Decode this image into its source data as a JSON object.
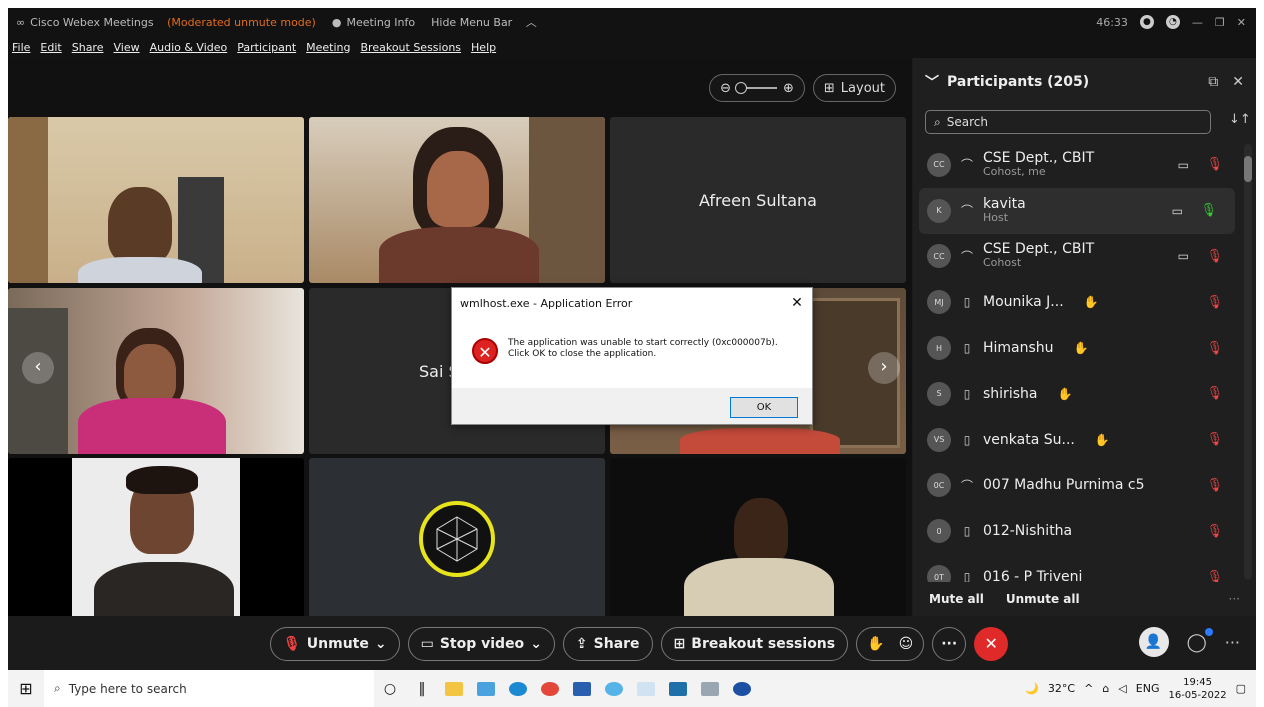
{
  "titlebar": {
    "app": "Cisco Webex Meetings",
    "mode": "(Moderated unmute mode)",
    "meeting_info": "Meeting Info",
    "hide_menu": "Hide Menu Bar",
    "timer": "46:33"
  },
  "menu": [
    "File",
    "Edit",
    "Share",
    "View",
    "Audio & Video",
    "Participant",
    "Meeting",
    "Breakout Sessions",
    "Help"
  ],
  "stage": {
    "layout_label": "Layout",
    "tiles": [
      {
        "name": "Afreen Sultana"
      },
      {
        "name": "Sai S"
      }
    ]
  },
  "dialog": {
    "title": "wmlhost.exe - Application Error",
    "message_line1": "The application was unable to start correctly (0xc000007b).",
    "message_line2": "Click OK to close the application.",
    "ok": "OK"
  },
  "panel": {
    "title": "Participants (205)",
    "search_placeholder": "Search",
    "participants": [
      {
        "initials": "CC",
        "name": "CSE Dept., CBIT",
        "role": "Cohost, me",
        "device": "headset",
        "video": true,
        "mic": "muted"
      },
      {
        "initials": "K",
        "name": "kavita",
        "role": "Host",
        "device": "headset",
        "video": true,
        "mic": "on"
      },
      {
        "initials": "CC",
        "name": "CSE Dept., CBIT",
        "role": "Cohost",
        "device": "headset",
        "video": true,
        "mic": "muted"
      },
      {
        "initials": "MJ",
        "name": "Mounika J...",
        "role": "",
        "device": "mobile",
        "hand": true,
        "mic": "muted"
      },
      {
        "initials": "H",
        "name": "Himanshu",
        "role": "",
        "device": "mobile",
        "hand": true,
        "mic": "muted"
      },
      {
        "initials": "S",
        "name": "shirisha",
        "role": "",
        "device": "mobile",
        "hand": true,
        "mic": "muted"
      },
      {
        "initials": "VS",
        "name": "venkata Su...",
        "role": "",
        "device": "mobile",
        "hand": true,
        "mic": "muted"
      },
      {
        "initials": "0C",
        "name": "007 Madhu Purnima c5",
        "role": "",
        "device": "headset",
        "mic": "muted"
      },
      {
        "initials": "0",
        "name": "012-Nishitha",
        "role": "",
        "device": "mobile",
        "mic": "muted"
      },
      {
        "initials": "0T",
        "name": "016 - P Triveni",
        "role": "",
        "device": "mobile",
        "mic": "muted"
      }
    ],
    "mute_all": "Mute all",
    "unmute_all": "Unmute all"
  },
  "controls": {
    "unmute": "Unmute",
    "stop_video": "Stop video",
    "share": "Share",
    "breakout": "Breakout sessions"
  },
  "taskbar": {
    "search_placeholder": "Type here to search",
    "weather": "32°C",
    "lang": "ENG",
    "time": "19:45",
    "date": "16-05-2022"
  },
  "colors": {
    "accent": "#2b7bff",
    "danger": "#e02a2a",
    "mode": "#e36b1c"
  }
}
